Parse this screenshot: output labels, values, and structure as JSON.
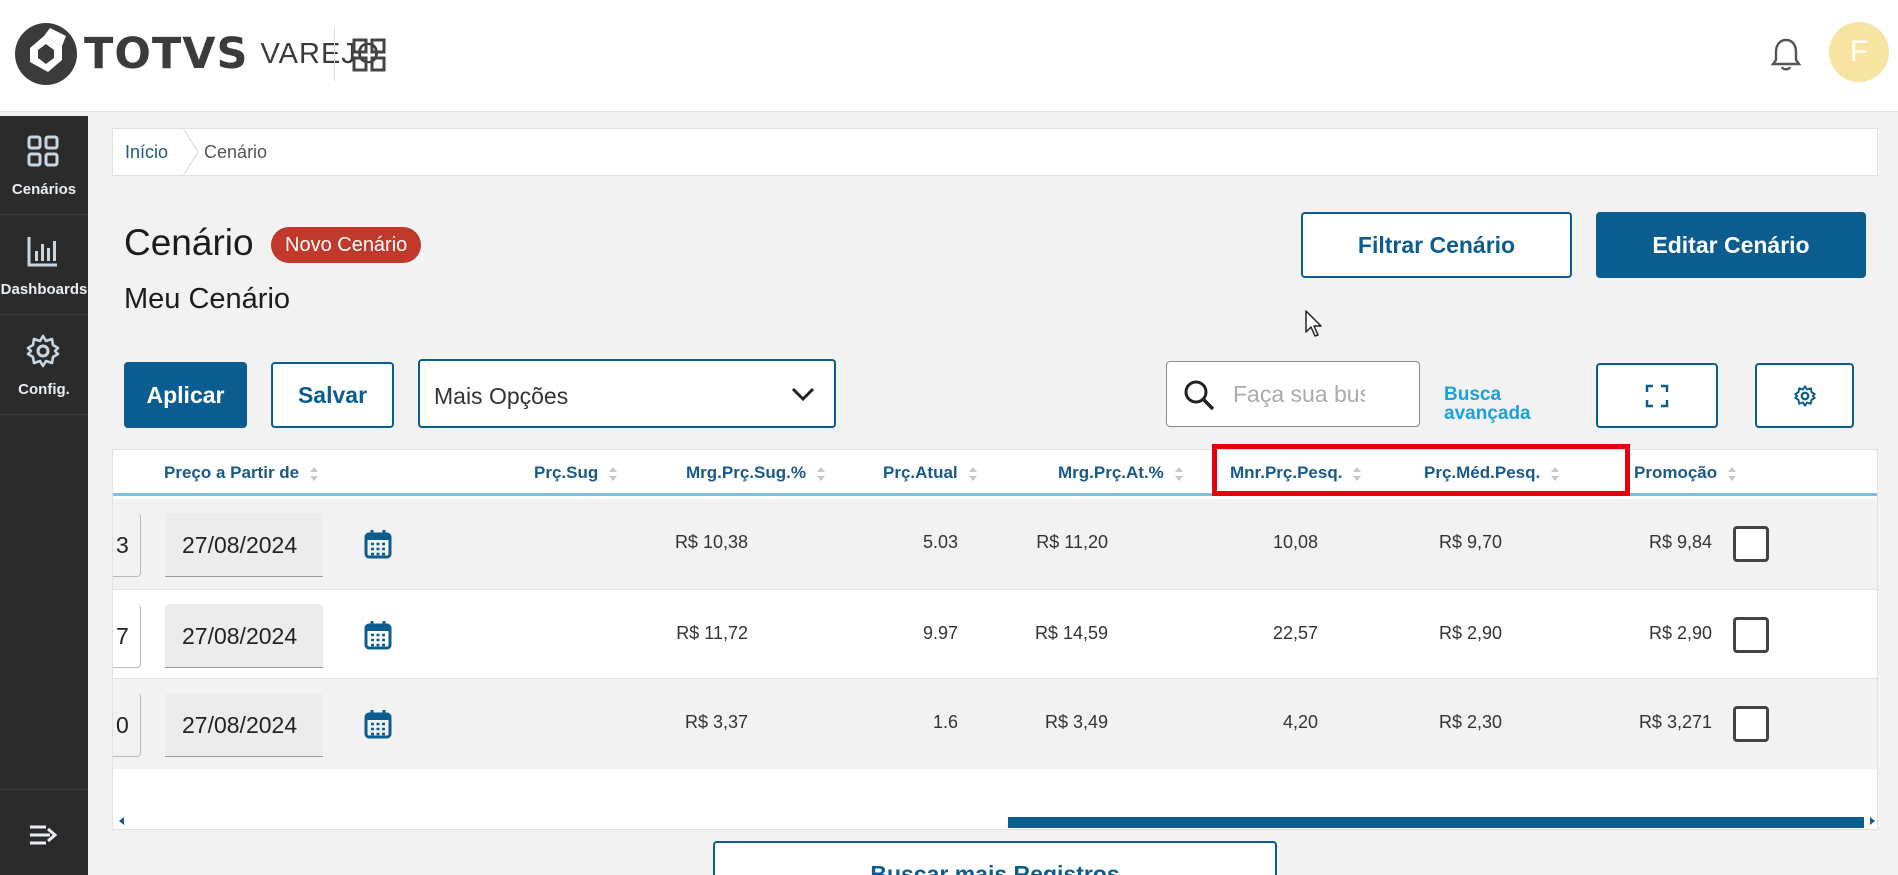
{
  "header": {
    "brand": "TOTVS",
    "product": "VAREJO",
    "avatar_initial": "F"
  },
  "sidebar": {
    "items": [
      {
        "label": "Cenários",
        "icon": "grid-icon"
      },
      {
        "label": "Dashboards",
        "icon": "bar-chart-icon"
      },
      {
        "label": "Config.",
        "icon": "gear-icon"
      }
    ]
  },
  "breadcrumb": {
    "home": "Início",
    "current": "Cenário"
  },
  "page": {
    "title": "Cenário",
    "badge": "Novo Cenário",
    "subtitle": "Meu Cenário",
    "filter_button": "Filtrar Cenário",
    "edit_button": "Editar Cenário"
  },
  "toolbar": {
    "apply": "Aplicar",
    "save": "Salvar",
    "more_options": "Mais Opções",
    "search_placeholder": "Faça sua busca",
    "advanced_search_line1": "Busca",
    "advanced_search_line2": "avançada"
  },
  "table": {
    "columns": [
      "Preço a Partir de",
      "Prç.Sug",
      "Mrg.Prç.Sug.%",
      "Prç.Atual",
      "Mrg.Prç.At.%",
      "Mnr.Prç.Pesq.",
      "Prç.Méd.Pesq.",
      "Promoção"
    ],
    "rows": [
      {
        "cut": "3",
        "date": "27/08/2024",
        "prc_sug": "R$ 10,38",
        "mrg_sug": "5.03",
        "prc_atual": "R$ 11,20",
        "mrg_at": "10,08",
        "mnr_pesq": "R$ 9,70",
        "med_pesq": "R$ 9,84"
      },
      {
        "cut": "7",
        "date": "27/08/2024",
        "prc_sug": "R$ 11,72",
        "mrg_sug": "9.97",
        "prc_atual": "R$ 14,59",
        "mrg_at": "22,57",
        "mnr_pesq": "R$ 2,90",
        "med_pesq": "R$ 2,90"
      },
      {
        "cut": "0",
        "date": "27/08/2024",
        "prc_sug": "R$ 3,37",
        "mrg_sug": "1.6",
        "prc_atual": "R$ 3,49",
        "mrg_at": "4,20",
        "mnr_pesq": "R$ 2,30",
        "med_pesq": "R$ 3,271"
      }
    ]
  },
  "footer": {
    "load_more": "Buscar mais Registros"
  },
  "colors": {
    "primary": "#0c5d8f",
    "badge": "#c0392b",
    "sidebar": "#2b2b2b",
    "highlight": "#e5000c",
    "link": "#1ea0d8"
  }
}
